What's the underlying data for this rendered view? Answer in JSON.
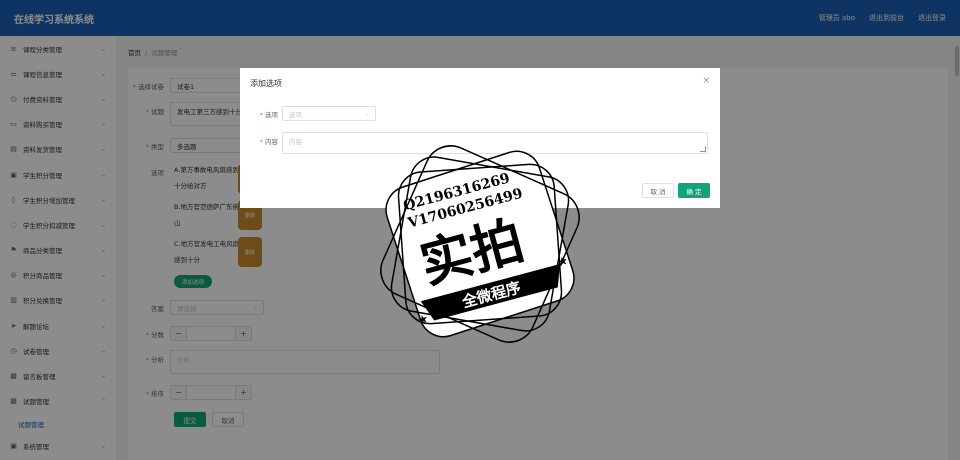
{
  "header": {
    "title": "在线学习系统系统",
    "user": "管理员 abo",
    "back_label": "退出到前台",
    "logout_label": "退出登录"
  },
  "sidebar": {
    "items": [
      {
        "label": "课程分类管理",
        "icon": "list-icon"
      },
      {
        "label": "课程信息管理",
        "icon": "sliders-icon"
      },
      {
        "label": "付费资料管理",
        "icon": "clock-icon"
      },
      {
        "label": "资料购买管理",
        "icon": "cart-icon"
      },
      {
        "label": "资料发货管理",
        "icon": "box-icon"
      },
      {
        "label": "学生积分管理",
        "icon": "coin-icon"
      },
      {
        "label": "学生积分增加管理",
        "icon": "drop-icon"
      },
      {
        "label": "学生积分扣减管理",
        "icon": "chat-icon"
      },
      {
        "label": "商品分类管理",
        "icon": "flag-icon"
      },
      {
        "label": "积分商品管理",
        "icon": "gift-icon"
      },
      {
        "label": "积分兑换管理",
        "icon": "swap-icon"
      },
      {
        "label": "解题论坛",
        "icon": "send-icon"
      },
      {
        "label": "试卷管理",
        "icon": "clock-icon"
      },
      {
        "label": "留言板管理",
        "icon": "message-icon"
      },
      {
        "label": "试题管理",
        "icon": "grid-icon"
      },
      {
        "label": "系统管理",
        "icon": "settings-icon"
      }
    ],
    "sub_active": "试题管理"
  },
  "breadcrumb": {
    "home": "首页",
    "separator": "/",
    "current": "试题管理"
  },
  "form": {
    "paper_label": "选择试卷",
    "paper_value": "试卷1",
    "question_label": "试题",
    "question_value": "发电工第三方感到十分感到十分",
    "type_label": "类型",
    "type_value": "多选题",
    "options_label": "选项",
    "options": [
      {
        "line1": "A.第方事故电风扇感到",
        "line2": "十分给对方"
      },
      {
        "line1": "B.地方官范德萨广东佛",
        "line2": "山"
      },
      {
        "line1": "C.地方官发电工电风扇",
        "line2": "感到十分"
      }
    ],
    "delete_label": "删除",
    "add_option_label": "添加选项",
    "answer_label": "答案",
    "answer_placeholder": "请选择",
    "score_label": "分数",
    "analysis_label": "分析",
    "analysis_placeholder": "分析",
    "sort_label": "排序",
    "minus": "−",
    "plus": "+",
    "submit_label": "提交",
    "cancel_label": "取消"
  },
  "dialog": {
    "title": "添加选项",
    "close": "×",
    "option_label": "选项",
    "option_placeholder": "选项",
    "content_label": "内容",
    "content_placeholder": "内容",
    "cancel_label": "取 消",
    "ok_label": "确 定"
  },
  "watermark": {
    "line1": "Q2196316269",
    "line2": "V17060256499",
    "main": "实拍",
    "banner": "全微程序"
  }
}
